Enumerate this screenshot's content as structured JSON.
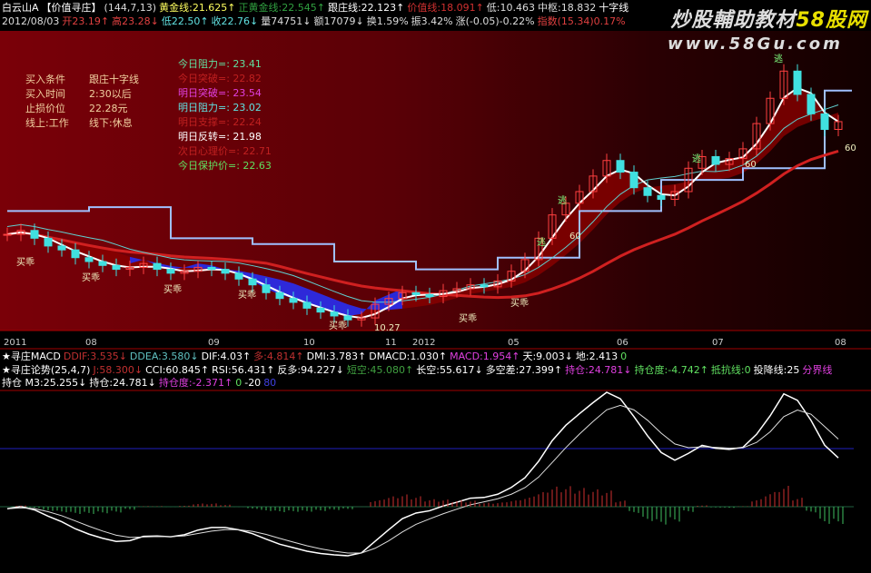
{
  "header": {
    "row1": [
      {
        "text": "白云山A",
        "color": "#ffffff"
      },
      {
        "text": "【价值寻庄】",
        "color": "#ffffff"
      },
      {
        "text": "(144,7,13)",
        "color": "#dddddd"
      },
      {
        "text": "黄金线:21.625↑",
        "color": "#ffff60"
      },
      {
        "text": "正黄金线:22.545↑",
        "color": "#30a040"
      },
      {
        "text": "跟庄线:22.123↑",
        "color": "#ffffff"
      },
      {
        "text": "价值线:18.091↑",
        "color": "#d03030"
      },
      {
        "text": "低:10.463",
        "color": "#dddddd"
      },
      {
        "text": "中枢:18.832",
        "color": "#dddddd"
      },
      {
        "text": "十字线",
        "color": "#ffffff"
      }
    ],
    "row2": [
      {
        "text": "2012/08/03",
        "color": "#dddddd"
      },
      {
        "text": "开23.19↑",
        "color": "#e04040"
      },
      {
        "text": "高23.28↓",
        "color": "#e04040"
      },
      {
        "text": "低22.50↑",
        "color": "#60e0e0"
      },
      {
        "text": "收22.76↓",
        "color": "#60e0e0"
      },
      {
        "text": "量74751↓",
        "color": "#dddddd"
      },
      {
        "text": "额17079↓",
        "color": "#dddddd"
      },
      {
        "text": "换1.59%",
        "color": "#dddddd"
      },
      {
        "text": "振3.42%",
        "color": "#dddddd"
      },
      {
        "text": "涨(-0.05)-0.22%",
        "color": "#dddddd"
      },
      {
        "text": "指数(15.34)0.17%",
        "color": "#e04040"
      }
    ],
    "watermark": "炒股輔助教材",
    "watermark_num": "58股网",
    "url": "www.58Gu.com"
  },
  "conditions": [
    {
      "label": "买入条件",
      "value": "跟庄十字线"
    },
    {
      "label": "买入时间",
      "value": "2:30以后"
    },
    {
      "label": "止损价位",
      "value": "22.28元"
    },
    {
      "label": "线上:工作",
      "value": "线下:休息"
    }
  ],
  "levels": [
    {
      "text": "今日阻力=: 23.41",
      "color": "#60e0a0"
    },
    {
      "text": "今日突破=: 22.82",
      "color": "#c02020"
    },
    {
      "text": "明日突破=: 23.54",
      "color": "#e040e0"
    },
    {
      "text": "明日阻力=: 23.02",
      "color": "#60e0e0"
    },
    {
      "text": "明日支撑=: 22.24",
      "color": "#c02020"
    },
    {
      "text": "明日反转=: 21.98",
      "color": "#ffffff"
    },
    {
      "text": "次日心理价=: 22.71",
      "color": "#c02020"
    },
    {
      "text": "今日保护价=: 22.63",
      "color": "#60e060"
    }
  ],
  "indicators": {
    "row1": [
      {
        "text": "★寻庄MACD",
        "color": "#ffffff"
      },
      {
        "text": "DDIF:3.535↓",
        "color": "#c03030"
      },
      {
        "text": "DDEA:3.580↓",
        "color": "#60c0c0"
      },
      {
        "text": "DIF:4.03↑",
        "color": "#ffffff"
      },
      {
        "text": "多:4.814↑",
        "color": "#c03030"
      },
      {
        "text": "DMI:3.783↑",
        "color": "#ffffff"
      },
      {
        "text": "DMACD:1.030↑",
        "color": "#ffffff"
      },
      {
        "text": "MACD:1.954↑",
        "color": "#e040e0"
      },
      {
        "text": "天:9.003↓",
        "color": "#ffffff"
      },
      {
        "text": "地:2.413",
        "color": "#ffffff"
      },
      {
        "text": "0",
        "color": "#60e060"
      }
    ],
    "row2": [
      {
        "text": "★寻庄论势(25,4,7)",
        "color": "#ffffff"
      },
      {
        "text": "J:58.300↓",
        "color": "#c03030"
      },
      {
        "text": "CCI:60.845↑",
        "color": "#ffffff"
      },
      {
        "text": "RSI:56.431↑",
        "color": "#ffffff"
      },
      {
        "text": "反多:94.227↓",
        "color": "#ffffff"
      },
      {
        "text": "短空:45.080↑",
        "color": "#40a040"
      },
      {
        "text": "长空:55.617↓",
        "color": "#ffffff"
      },
      {
        "text": "多空差:27.399↑",
        "color": "#ffffff"
      },
      {
        "text": "持仓:24.781↓",
        "color": "#e040e0"
      },
      {
        "text": "持仓度:-4.742↑",
        "color": "#60e060"
      },
      {
        "text": "抵抗线:0",
        "color": "#60e060"
      },
      {
        "text": "投降线:25",
        "color": "#ffffff"
      },
      {
        "text": "分界线",
        "color": "#e040e0"
      }
    ],
    "row3": [
      {
        "text": "持仓 M3:25.255↓",
        "color": "#ffffff"
      },
      {
        "text": "持仓:24.781↓",
        "color": "#ffffff"
      },
      {
        "text": "持仓度:-2.371↑",
        "color": "#e040e0"
      },
      {
        "text": "0",
        "color": "#60e060"
      },
      {
        "text": "-20",
        "color": "#ffffff"
      },
      {
        "text": "80",
        "color": "#4040e0"
      }
    ]
  },
  "annotations": {
    "low_price": "10.27",
    "buy": "买乖",
    "escape": "逃",
    "sixty": "60"
  },
  "chart_data": {
    "type": "candlestick",
    "title": "白云山A",
    "xlabel": "",
    "ylabel": "",
    "time_labels": [
      {
        "label": "2011",
        "bar": 0
      },
      {
        "label": "08",
        "bar": 6
      },
      {
        "label": "09",
        "bar": 15
      },
      {
        "label": "10",
        "bar": 22
      },
      {
        "label": "11",
        "bar": 28
      },
      {
        "label": "2012",
        "bar": 30
      },
      {
        "label": "05",
        "bar": 37
      },
      {
        "label": "06",
        "bar": 45
      },
      {
        "label": "07",
        "bar": 52
      },
      {
        "label": "08",
        "bar": 61
      }
    ],
    "ylim": [
      10.27,
      24.0
    ],
    "close": [
      14.8,
      15.0,
      14.6,
      14.2,
      14.0,
      13.6,
      13.4,
      13.2,
      13.0,
      13.1,
      13.3,
      13.0,
      12.8,
      12.9,
      13.1,
      13.0,
      12.8,
      12.5,
      12.2,
      11.8,
      11.5,
      11.3,
      11.0,
      10.8,
      10.6,
      10.4,
      10.5,
      11.2,
      11.5,
      11.8,
      11.7,
      11.6,
      11.9,
      12.0,
      12.2,
      12.1,
      12.4,
      12.9,
      13.5,
      14.6,
      15.8,
      16.4,
      17.0,
      17.8,
      18.6,
      18.0,
      17.2,
      16.8,
      16.6,
      17.0,
      18.2,
      18.8,
      18.4,
      18.7,
      19.2,
      20.5,
      21.8,
      23.2,
      22.0,
      21.0,
      20.2,
      20.6
    ],
    "series": [
      {
        "name": "跟庄线"
      },
      {
        "name": "价值线"
      },
      {
        "name": "中枢"
      },
      {
        "name": "DIF"
      },
      {
        "name": "DEA"
      },
      {
        "name": "MACD"
      }
    ]
  }
}
